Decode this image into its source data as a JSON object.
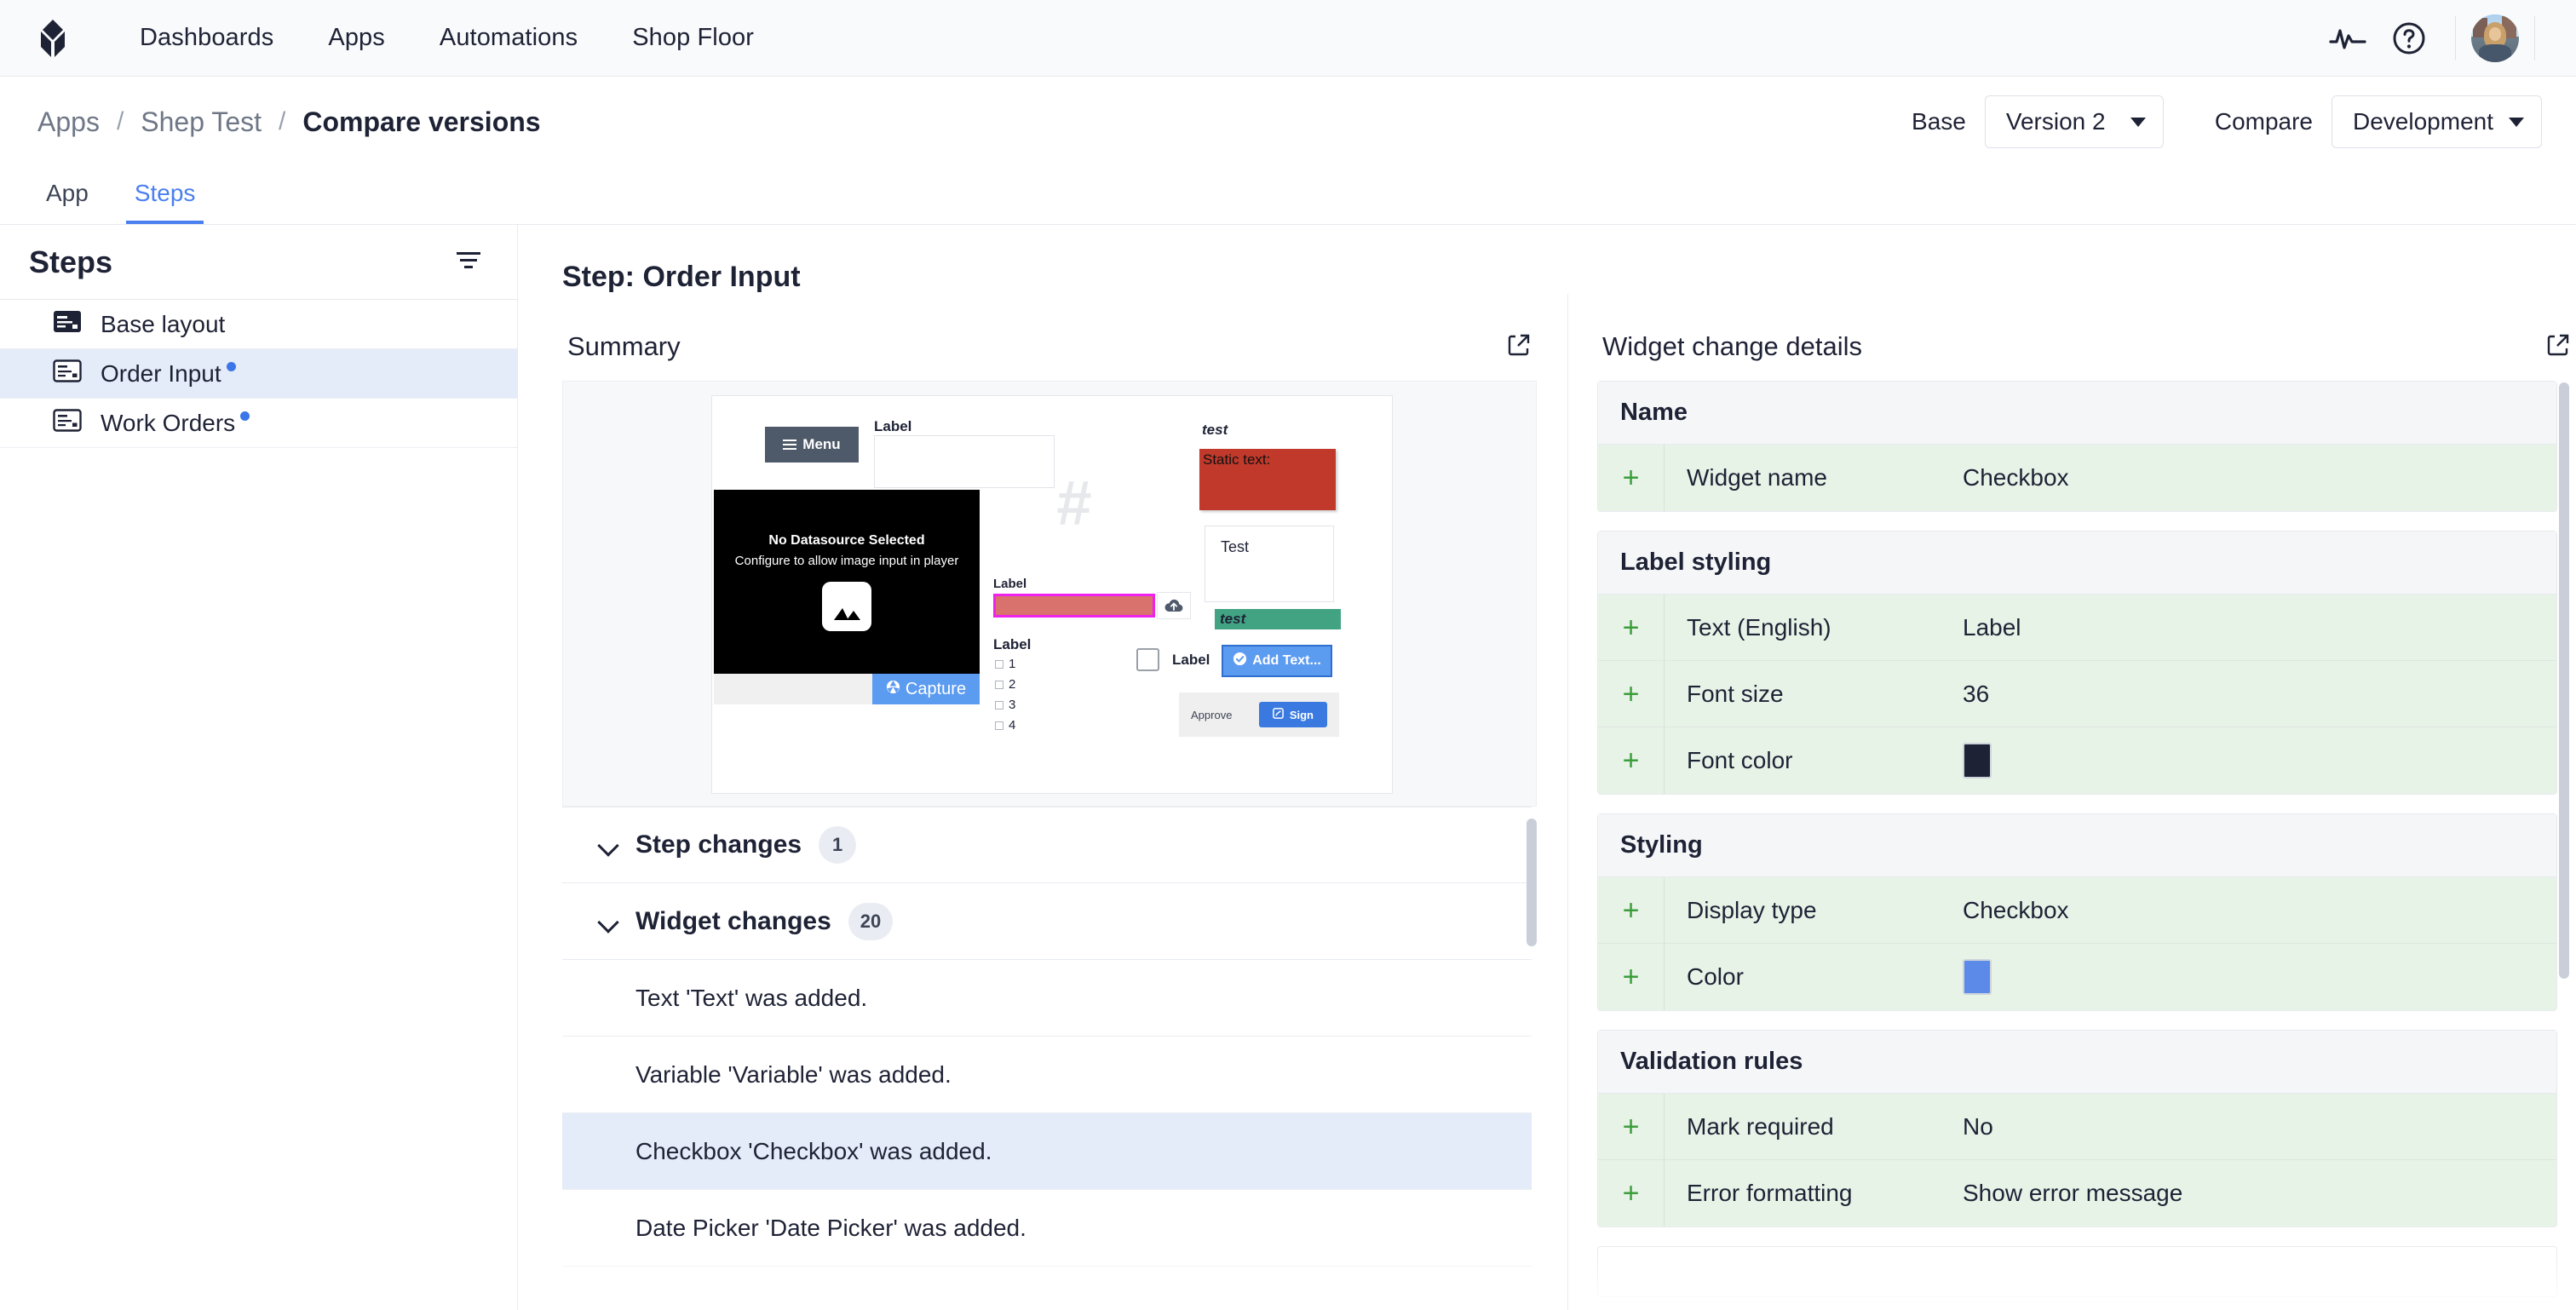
{
  "topnav": {
    "logo_name": "tulip-logo",
    "links": [
      {
        "label": "Dashboards"
      },
      {
        "label": "Apps"
      },
      {
        "label": "Automations"
      },
      {
        "label": "Shop Floor"
      }
    ],
    "icons": [
      {
        "name": "activity-pulse-icon"
      },
      {
        "name": "help-circle-icon"
      }
    ],
    "avatar_name": "user-avatar"
  },
  "breadcrumb": {
    "items": [
      {
        "label": "Apps",
        "active": false
      },
      {
        "label": "Shep Test",
        "active": false
      },
      {
        "label": "Compare versions",
        "active": true
      }
    ],
    "separator": "/"
  },
  "versions": {
    "base_label": "Base",
    "base_value": "Version 2",
    "compare_label": "Compare",
    "compare_value": "Development"
  },
  "tabs": [
    {
      "label": "App",
      "active": false
    },
    {
      "label": "Steps",
      "active": true
    }
  ],
  "sidebar": {
    "title": "Steps",
    "filter_icon": "filter-icon",
    "items": [
      {
        "label": "Base layout",
        "selected": false,
        "changed": false,
        "icon": "step-filled-icon"
      },
      {
        "label": "Order Input",
        "selected": true,
        "changed": true,
        "icon": "step-outline-icon"
      },
      {
        "label": "Work Orders",
        "selected": false,
        "changed": true,
        "icon": "step-outline-icon"
      }
    ]
  },
  "main": {
    "step_title": "Step: Order Input",
    "summary": {
      "title": "Summary",
      "expand_icon": "external-link-icon",
      "preview": {
        "menu_button": "Menu",
        "label_top": "Label",
        "black_title": "No Datasource Selected",
        "black_subtitle": "Configure to allow image input in player",
        "image_placeholder_icon": "image-icon",
        "capture_button": "Capture",
        "capture_icon": "aperture-icon",
        "hash_icon": "hash-placeholder-icon",
        "label_mid": "Label",
        "upload_icon": "cloud-upload-icon",
        "checkbox_group_label": "Label",
        "checkbox_options": [
          "1",
          "2",
          "3",
          "4"
        ],
        "italic_test": "test",
        "static_text": "Static text:",
        "test_box_text": "Test",
        "green_test": "test",
        "checkbox_label": "Label",
        "add_text_button": "Add Text...",
        "add_text_icon": "check-circle-icon",
        "approve_label": "Approve",
        "sign_button": "Sign",
        "sign_icon": "signature-icon"
      }
    },
    "accordions": [
      {
        "label": "Step changes",
        "count": "1",
        "expanded": true
      },
      {
        "label": "Widget changes",
        "count": "20",
        "expanded": true
      }
    ],
    "widget_changes": [
      {
        "text": "Text 'Text' was added.",
        "selected": false
      },
      {
        "text": "Variable 'Variable' was added.",
        "selected": false
      },
      {
        "text": "Checkbox 'Checkbox' was added.",
        "selected": true
      },
      {
        "text": "Date Picker 'Date Picker' was added.",
        "selected": false
      }
    ]
  },
  "details": {
    "title": "Widget change details",
    "expand_icon": "external-link-icon",
    "groups": [
      {
        "heading": "Name",
        "rows": [
          {
            "marker": "+",
            "key": "Widget name",
            "value": "Checkbox",
            "type": "text"
          }
        ]
      },
      {
        "heading": "Label styling",
        "rows": [
          {
            "marker": "+",
            "key": "Text (English)",
            "value": "Label",
            "type": "text"
          },
          {
            "marker": "+",
            "key": "Font size",
            "value": "36",
            "type": "text"
          },
          {
            "marker": "+",
            "key": "Font color",
            "value": "#1e2235",
            "type": "color"
          }
        ]
      },
      {
        "heading": "Styling",
        "rows": [
          {
            "marker": "+",
            "key": "Display type",
            "value": "Checkbox",
            "type": "text"
          },
          {
            "marker": "+",
            "key": "Color",
            "value": "#5b8ae8",
            "type": "color"
          }
        ]
      },
      {
        "heading": "Validation rules",
        "rows": [
          {
            "marker": "+",
            "key": "Mark required",
            "value": "No",
            "type": "text"
          },
          {
            "marker": "+",
            "key": "Error formatting",
            "value": "Show error message",
            "type": "text"
          }
        ]
      }
    ]
  },
  "colors": {
    "accent_blue": "#4a7ff0",
    "selection_blue": "#e4ebf9",
    "added_green_bg": "#e7f3e7",
    "added_green_fg": "#3b9e3b",
    "text_dark": "#1e2235"
  }
}
